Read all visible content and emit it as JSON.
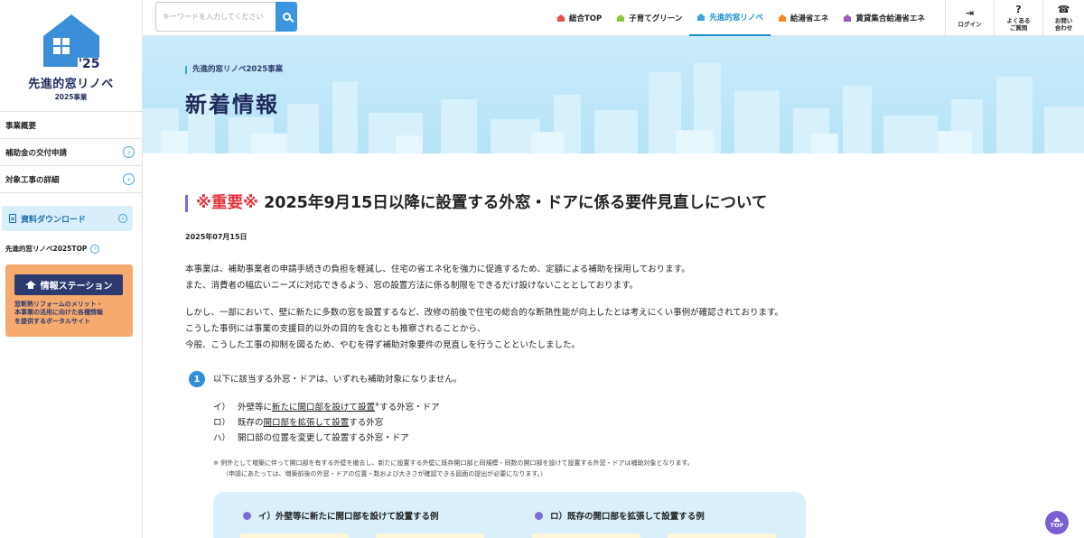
{
  "colors": {
    "accent_blue": "#3b95e0",
    "navy": "#1e2a5a",
    "important_red": "#e5323b",
    "purple": "#7b6bd6",
    "station_orange": "#f7aa6d",
    "hero_sky": "#c9ebfb"
  },
  "logo": {
    "year": "'25",
    "title": "先進的窓リノベ",
    "subtitle": "2025事業"
  },
  "sidebar": {
    "items": [
      {
        "label": "事業概要",
        "icon": ""
      },
      {
        "label": "補助金の交付申請",
        "icon": "chevron-right-icon"
      },
      {
        "label": "対象工事の詳細",
        "icon": "chevron-right-icon"
      }
    ],
    "download_label": "資料ダウンロード",
    "top_link": "先進的窓リノベ2025TOP",
    "station": {
      "button": "情報ステーション",
      "desc1": "窓断熱リフォームのメリット・",
      "desc2": "本事業の活用に向けた各種情報",
      "desc3": "を提供するポータルサイト"
    }
  },
  "header": {
    "search_placeholder": "キーワードを入力してください",
    "nav": [
      {
        "label": "総合TOP",
        "color": "#e2534b"
      },
      {
        "label": "子育てグリーン",
        "color": "#8cc63f"
      },
      {
        "label": "先進的窓リノベ",
        "color": "#3aa7d8"
      },
      {
        "label": "給湯省エネ",
        "color": "#f08a24"
      },
      {
        "label": "賃貸集合給湯省エネ",
        "color": "#9b59b6"
      }
    ],
    "utility": {
      "login": "ログイン",
      "faq_line1": "よくある",
      "faq_line2": "ご質問",
      "contact_line1": "お問い",
      "contact_line2": "合わせ"
    }
  },
  "hero": {
    "breadcrumb": "先進的窓リノベ2025事業",
    "title": "新着情報"
  },
  "article": {
    "title_prefix": "※重要※",
    "title": " 2025年9月15日以降に設置する外窓・ドアに係る要件見直しについて",
    "date": "2025年07月15日",
    "p1_l1": "本事業は、補助事業者の申請手続きの負担を軽減し、住宅の省エネ化を強力に促進するため、定額による補助を採用しております。",
    "p1_l2": "また、消費者の幅広いニーズに対応できるよう、窓の設置方法に係る制限をできるだけ設けないこととしております。",
    "p2_l1": "しかし、一部において、壁に新たに多数の窓を設置するなど、改修の前後で住宅の総合的な断熱性能が向上したとは考えにくい事例が確認されております。",
    "p2_l2": "こうした事例には事業の支援目的以外の目的を含むとも推察されることから、",
    "p2_l3": "今般、こうした工事の抑制を図るため、やむを得ず補助対象要件の見直しを行うことといたしました。",
    "point_number": "1",
    "point_text": "以下に該当する外窓・ドアは、いずれも補助対象になりません。",
    "list": {
      "i_label": "イ）",
      "i_pre": "外壁等に",
      "i_under": "新たに開口部を設けて設置",
      "i_sup": "※",
      "i_post": "する外窓・ドア",
      "ro_label": "ロ）",
      "ro_pre": "既存の",
      "ro_under": "開口部を拡張して設置",
      "ro_post": "する外窓",
      "ha_label": "ハ）",
      "ha_text": "開口部の位置を変更して設置する外窓・ドア"
    },
    "note_l1": "※ 例外として増築に伴って開口部を有する外壁を撤去し、新たに設置する外壁に既存開口部と同規模・同数の開口部を設けて設置する外窓・ドアは補助対象となります。",
    "note_l2": "（申請にあたっては、増築前後の外窓・ドアの位置・数および大きさが確認できる図面の提出が必要になります。）",
    "example1": "イ）外壁等に新たに開口部を設けて設置する例",
    "example2": "ロ）既存の開口部を拡張して設置する例"
  },
  "top_button": "TOP"
}
